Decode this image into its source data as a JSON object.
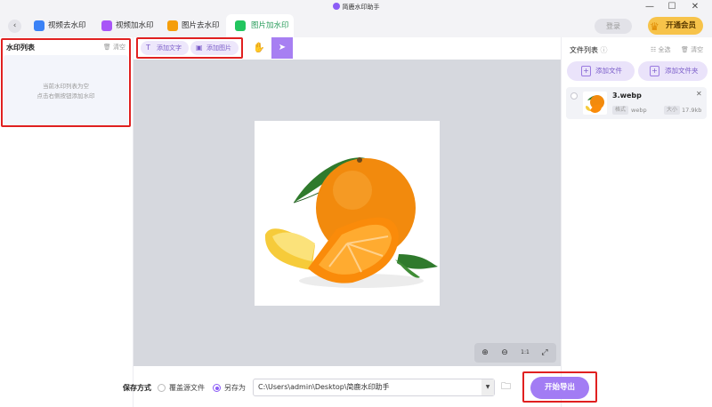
{
  "window": {
    "title": "简鹿水印助手",
    "minimize": "—",
    "maximize": "☐",
    "close": "✕"
  },
  "tabs": [
    {
      "label": "视频去水印",
      "icon": "video-remove-icon",
      "color": "#3b82f6"
    },
    {
      "label": "视频加水印",
      "icon": "video-add-icon",
      "color": "#a855f7"
    },
    {
      "label": "图片去水印",
      "icon": "image-remove-icon",
      "color": "#f59e0b"
    },
    {
      "label": "图片加水印",
      "icon": "image-add-icon",
      "color": "#22c55e"
    }
  ],
  "header": {
    "back": "‹",
    "login": "登录",
    "vip": "开通会员"
  },
  "watermark_list": {
    "title": "水印列表",
    "clear": "清空",
    "empty_line1": "当前水印列表为空",
    "empty_line2": "点击右侧按钮添加水印"
  },
  "toolbar": {
    "add_text": "添加文字",
    "add_image": "添加图片"
  },
  "zoom": {
    "zoom_in": "⊕",
    "zoom_out": "⊖",
    "one_to_one": "1:1",
    "fit": "⤢"
  },
  "file_list": {
    "title": "文件列表",
    "select_all": "全选",
    "clear": "清空",
    "add_file": "添加文件",
    "add_folder": "添加文件夹",
    "files": [
      {
        "name": "3.webp",
        "format_label": "格式",
        "format": "webp",
        "size_label": "大小",
        "size": "17.9kb"
      }
    ]
  },
  "bottom": {
    "save_mode_label": "保存方式",
    "overwrite": "覆盖源文件",
    "save_as": "另存为",
    "path": "C:\\Users\\admin\\Desktop\\简鹿水印助手",
    "export": "开始导出"
  },
  "colors": {
    "accent": "#a27cf4",
    "highlight": "#e02020",
    "active_tab": "#2a9d5c"
  }
}
